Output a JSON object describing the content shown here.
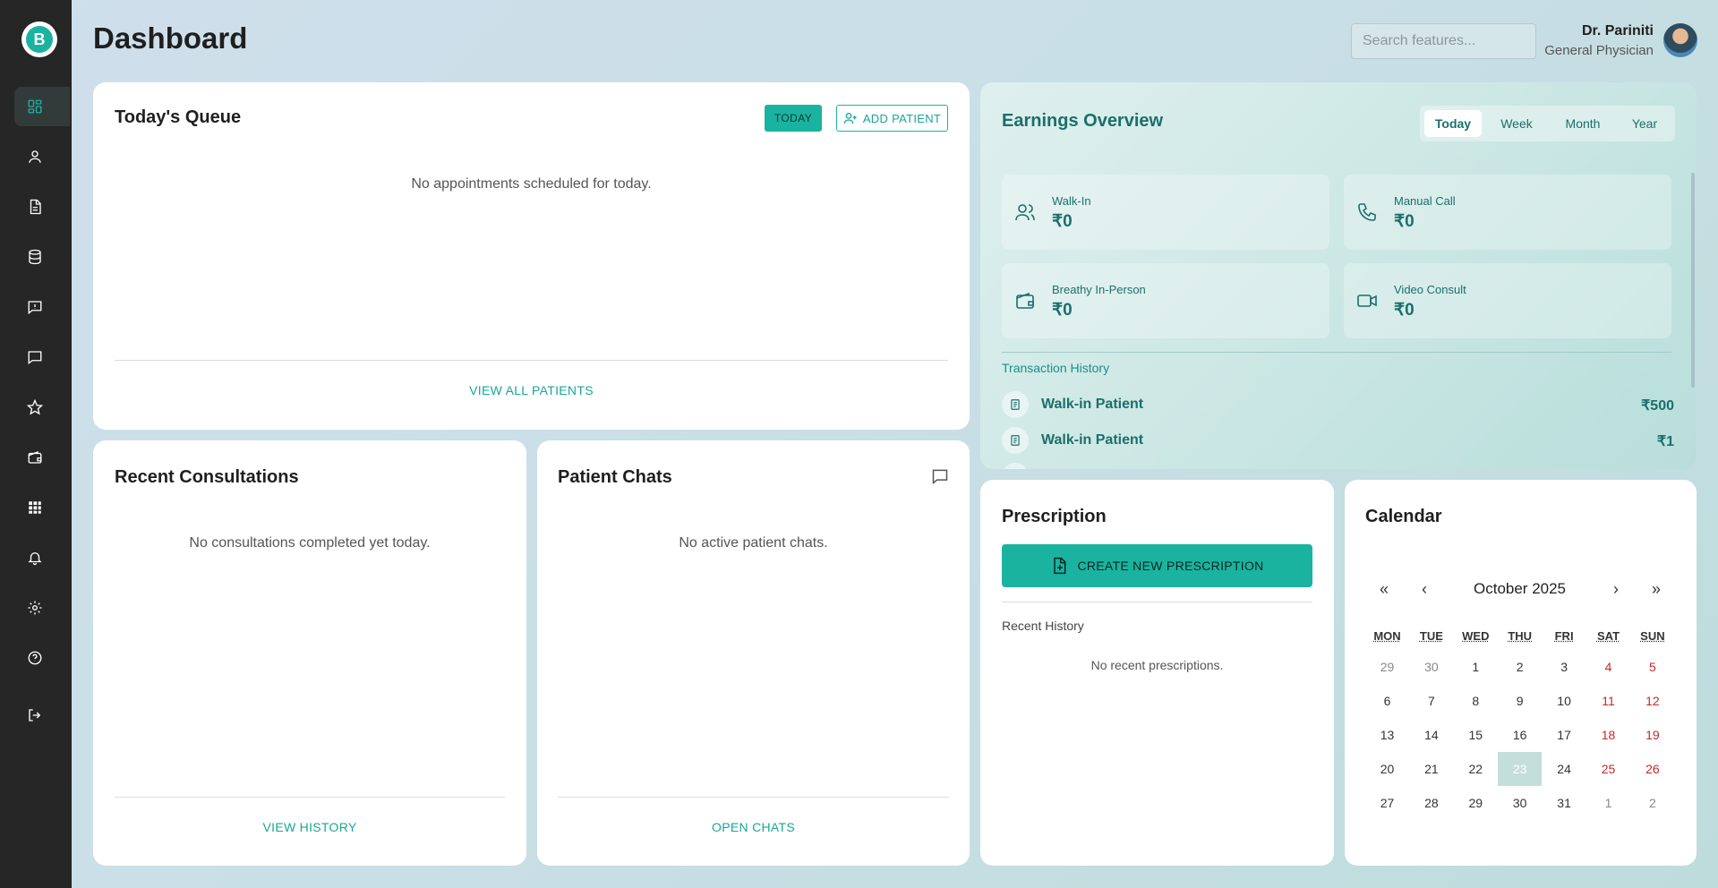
{
  "brand": {
    "logo_letter": "B"
  },
  "page": {
    "title": "Dashboard"
  },
  "header": {
    "search_placeholder": "Search features...",
    "user_name": "Dr. Pariniti",
    "user_role": "General Physician"
  },
  "sidebar": {
    "items": [
      {
        "icon": "dashboard-icon",
        "active": true
      },
      {
        "icon": "user-icon"
      },
      {
        "icon": "document-icon"
      },
      {
        "icon": "database-icon"
      },
      {
        "icon": "chat-report-icon"
      },
      {
        "icon": "message-icon"
      },
      {
        "icon": "star-icon"
      },
      {
        "icon": "wallet-icon"
      },
      {
        "icon": "apps-grid-icon"
      },
      {
        "icon": "bell-icon"
      },
      {
        "icon": "gear-icon"
      },
      {
        "icon": "help-icon"
      },
      {
        "icon": "logout-icon"
      }
    ]
  },
  "queue": {
    "title": "Today's Queue",
    "today_label": "TODAY",
    "add_label": "ADD PATIENT",
    "empty": "No appointments scheduled for today.",
    "view_all": "VIEW ALL PATIENTS"
  },
  "consultations": {
    "title": "Recent Consultations",
    "empty": "No consultations completed yet today.",
    "link": "VIEW HISTORY"
  },
  "chats": {
    "title": "Patient Chats",
    "empty": "No active patient chats.",
    "link": "OPEN CHATS"
  },
  "earnings": {
    "title": "Earnings Overview",
    "periods": [
      "Today",
      "Week",
      "Month",
      "Year"
    ],
    "selected_period": "Today",
    "stats": [
      {
        "label": "Walk-In",
        "value": "₹0",
        "icon": "users-icon"
      },
      {
        "label": "Manual Call",
        "value": "₹0",
        "icon": "phone-icon"
      },
      {
        "label": "Breathy In-Person",
        "value": "₹0",
        "icon": "wallet-icon"
      },
      {
        "label": "Video Consult",
        "value": "₹0",
        "icon": "video-icon"
      }
    ],
    "history_title": "Transaction History",
    "transactions": [
      {
        "name": "Walk-in Patient",
        "amount": "₹500"
      },
      {
        "name": "Walk-in Patient",
        "amount": "₹1"
      }
    ]
  },
  "prescription": {
    "title": "Prescription",
    "create_label": "CREATE NEW PRESCRIPTION",
    "recent_title": "Recent History",
    "empty": "No recent prescriptions."
  },
  "calendar": {
    "title": "Calendar",
    "month_label": "October 2025",
    "nav": {
      "prev_year": "«",
      "prev_month": "‹",
      "next_month": "›",
      "next_year": "»"
    },
    "weekdays": [
      "MON",
      "TUE",
      "WED",
      "THU",
      "FRI",
      "SAT",
      "SUN"
    ],
    "weeks": [
      [
        "29",
        "30",
        "1",
        "2",
        "3",
        "4",
        "5"
      ],
      [
        "6",
        "7",
        "8",
        "9",
        "10",
        "11",
        "12"
      ],
      [
        "13",
        "14",
        "15",
        "16",
        "17",
        "18",
        "19"
      ],
      [
        "20",
        "21",
        "22",
        "23",
        "24",
        "25",
        "26"
      ],
      [
        "27",
        "28",
        "29",
        "30",
        "31",
        "1",
        "2"
      ]
    ],
    "selected_day": "23",
    "colors": {
      "weekend": "#c62828",
      "selected_bg": "#c4dedb"
    }
  },
  "colors": {
    "accent": "#1ab3a0",
    "sidebar_bg": "#262626",
    "earnings_text": "#1b6f6a"
  }
}
